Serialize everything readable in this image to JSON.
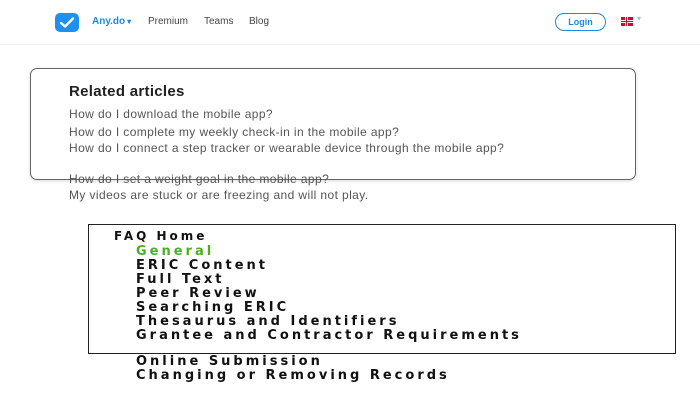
{
  "header": {
    "brand": "Any.do",
    "brand_caret": "▾",
    "nav": [
      "Premium",
      "Teams",
      "Blog"
    ],
    "login_label": "Login",
    "language_caret": "▾",
    "colors": {
      "brand_blue": "#1e88e5",
      "logo_blue": "#1e90f0"
    }
  },
  "related": {
    "title": "Related articles",
    "articles": [
      "How do I download the mobile app?",
      "How do I complete my weekly check-in in the mobile app?",
      "How do I connect a step tracker or wearable device through the mobile app?",
      "How do I set a weight goal in the mobile app?",
      "My videos are stuck or are freezing and will not play."
    ]
  },
  "faq": {
    "title": "FAQ Home",
    "active_color": "#4caf22",
    "links": [
      "General",
      "ERIC Content",
      "Full Text",
      "Peer Review",
      "Searching ERIC",
      "Thesaurus and Identifiers",
      "Grantee and Contractor Requirements",
      "Online Submission",
      "Changing or Removing Records"
    ]
  }
}
